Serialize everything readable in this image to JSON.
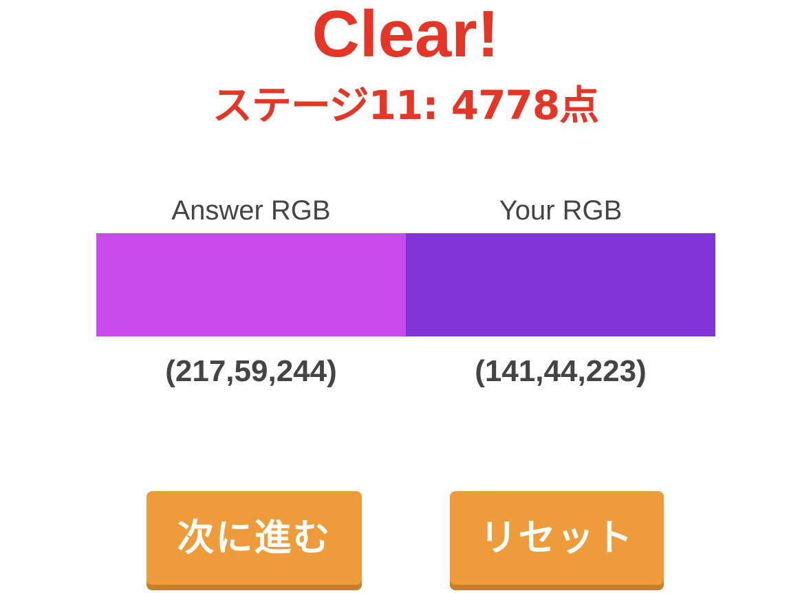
{
  "result": {
    "title": "Clear!",
    "score_text": "ステージ11: 4778点"
  },
  "answer": {
    "label": "Answer RGB",
    "rgb_text": "(217,59,244)",
    "color": "#c74ae9"
  },
  "yours": {
    "label": "Your RGB",
    "rgb_text": "(141,44,223)",
    "color": "#8033d6"
  },
  "buttons": {
    "next_label": "次に進む",
    "reset_label": "リセット"
  },
  "colors": {
    "accent": "#e53526",
    "button": "#ee9b3a"
  }
}
